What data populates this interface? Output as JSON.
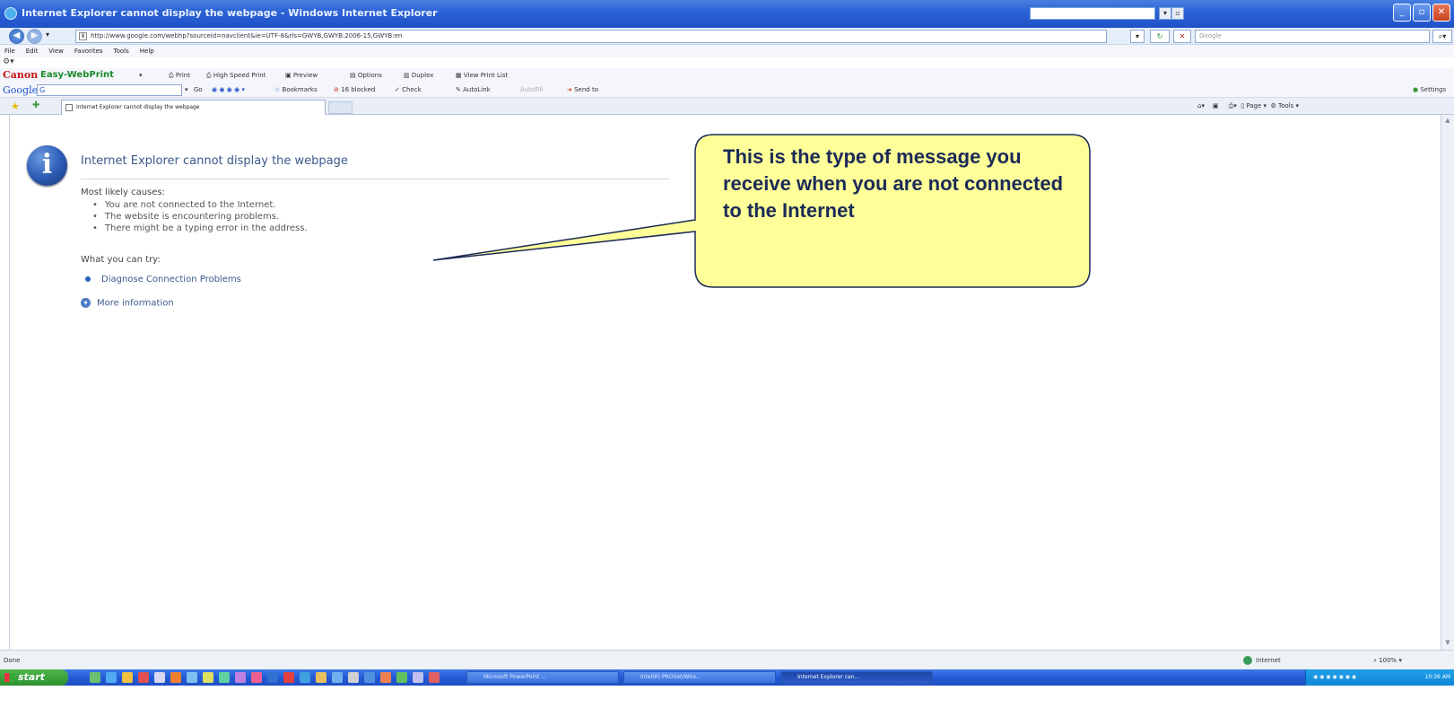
{
  "window": {
    "title": "Internet Explorer cannot display the webpage - Windows Internet Explorer",
    "minimize": "_",
    "maximize": "▫",
    "close": "✕"
  },
  "address": {
    "url": "http://www.google.com/webhp?sourceid=navclient&ie=UTF-8&rls=GWYB,GWYB:2006-15,GWYB:en",
    "search_placeholder": "Google",
    "search_icon": "search-icon"
  },
  "menu": [
    "File",
    "Edit",
    "View",
    "Favorites",
    "Tools",
    "Help"
  ],
  "canon": {
    "brand": "Canon",
    "product": "Easy-WebPrint",
    "items": [
      "Print",
      "High Speed Print",
      "Preview",
      "Options",
      "Duplex",
      "View Print List"
    ]
  },
  "google": {
    "logo": "Google",
    "input": "G",
    "items": [
      "Go",
      "Bookmarks",
      "16 blocked",
      "Check",
      "AutoLink",
      "AutoFill",
      "Send to"
    ],
    "settings": "Settings"
  },
  "tabs": [
    {
      "label": "Internet Explorer cannot display the webpage"
    }
  ],
  "command_bar": [
    "Page",
    "Tools"
  ],
  "error": {
    "title": "Internet Explorer cannot display the webpage",
    "causes_label": "Most likely causes:",
    "causes": [
      "You are not connected to the Internet.",
      "The website is encountering problems.",
      "There might be a typing error in the address."
    ],
    "try_label": "What you can try:",
    "diagnose": "Diagnose Connection Problems",
    "more_info": "More information"
  },
  "callout": {
    "text": "This is the type of message you receive when you are not connected to the Internet",
    "fill": "#ffff99",
    "stroke": "#1b2a57"
  },
  "status": {
    "text": "Done",
    "zone": "Internet",
    "zoom": "100%"
  },
  "taskbar": {
    "start": "start",
    "buttons": [
      "Microsoft PowerPoint ...",
      "Intel(R) PROSet/Wire...",
      "Internet Explorer can..."
    ],
    "clock": "10:36 AM"
  },
  "colors": {
    "titlebar": "#2c63d6",
    "link": "#3a5a8a",
    "taskbar": "#245ad6",
    "start": "#3a9a3a"
  }
}
